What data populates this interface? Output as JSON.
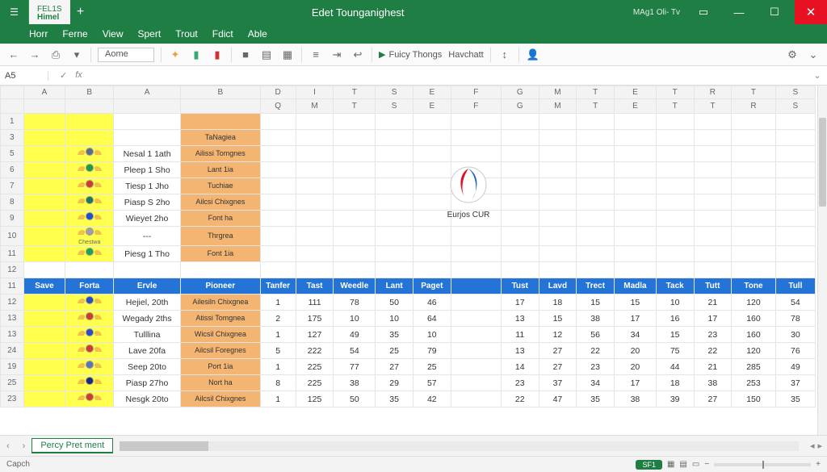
{
  "title": "Edet Tounganighest",
  "user": "MAg1 Oli- Tv",
  "filetab": {
    "line1": "FEL1S",
    "line2": "Himel"
  },
  "menu": [
    "Horr",
    "Ferne",
    "View",
    "Spert",
    "Trout",
    "Fdict",
    "Able"
  ],
  "toolbar": {
    "font": "Aome",
    "ft1": "Fuicy Thongs",
    "ft2": "Havchatt"
  },
  "namebox": "A5",
  "colLetters": [
    "A",
    "B",
    "A",
    "B",
    "D",
    "I",
    "T",
    "S",
    "E",
    "F",
    "G",
    "M",
    "T",
    "E",
    "T",
    "R",
    "T",
    "S"
  ],
  "colSub": [
    "",
    "",
    "",
    "",
    "Q",
    "M",
    "T",
    "S",
    "E",
    "F",
    "G",
    "M",
    "T",
    "E",
    "T",
    "T",
    "R",
    "S"
  ],
  "topRows": [
    {
      "n": "1",
      "a": "",
      "b": "",
      "a2": "",
      "b2": ""
    },
    {
      "n": "3",
      "a": "",
      "b": "",
      "a2": "",
      "b2": "TaNagiea"
    },
    {
      "n": "5",
      "a": "",
      "flag": "#5b6b8c",
      "a2": "Nesal 1 1ath",
      "b2": "Ailissi Tomgnes"
    },
    {
      "n": "6",
      "a": "",
      "flag": "#1a9e3e",
      "a2": "Pleep 1 Sho",
      "b2": "Lant 1ia"
    },
    {
      "n": "7",
      "a": "",
      "flag": "#d43a2a",
      "a2": "Tiesp 1 Jho",
      "b2": "Tuchiae"
    },
    {
      "n": "8",
      "a": "",
      "flag": "#1a7a5a",
      "a2": "Piasp S 2ho",
      "b2": "Ailcsi Chixgnes"
    },
    {
      "n": "9",
      "a": "",
      "flag": "#1a4fd4",
      "a2": "Wieyet 2ho",
      "b2": "Font ha"
    },
    {
      "n": "10",
      "a": "",
      "flag": "#a0a0a0",
      "a2": "---",
      "b2": "Thrgrea",
      "label": "Chestwa"
    },
    {
      "n": "11",
      "a": "",
      "flag": "#1aa74a",
      "a2": "Piesg 1 Tho",
      "b2": "Font 1ia"
    }
  ],
  "headerRow": [
    "Save",
    "Forta",
    "Ervle",
    "Pioneer",
    "Tanfer",
    "Tast",
    "Weedle",
    "Lant",
    "Paget",
    "",
    "Tust",
    "Lavd",
    "Trect",
    "Madla",
    "Tack",
    "Tutt",
    "Tone",
    "Tull"
  ],
  "dataRows": [
    {
      "n": "12",
      "flag": "#2a4ac7",
      "a2": "Hejiel, 20th",
      "b2": "Ailesiln Chixgnea",
      "v": [
        "1",
        "111",
        "78",
        "50",
        "46",
        "",
        "17",
        "18",
        "15",
        "15",
        "10",
        "21",
        "120",
        "54"
      ]
    },
    {
      "n": "13",
      "flag": "#d43a2a",
      "a2": "Wegady 2ths",
      "b2": "Atissi Tomgnea",
      "v": [
        "2",
        "175",
        "10",
        "10",
        "64",
        "",
        "13",
        "15",
        "38",
        "17",
        "16",
        "17",
        "160",
        "78"
      ]
    },
    {
      "n": "13",
      "flag": "#2a4ac7",
      "a2": "Tulllina",
      "b2": "Wicsil Chixgnea",
      "v": [
        "1",
        "127",
        "49",
        "35",
        "10",
        "",
        "11",
        "12",
        "56",
        "34",
        "15",
        "23",
        "160",
        "30"
      ]
    },
    {
      "n": "24",
      "flag": "#d43a2a",
      "a2": "Lave 20fa",
      "b2": "Ailcsil Foregnes",
      "v": [
        "5",
        "222",
        "54",
        "25",
        "79",
        "",
        "13",
        "27",
        "22",
        "20",
        "75",
        "22",
        "120",
        "76"
      ]
    },
    {
      "n": "19",
      "flag": "#5577bb",
      "a2": "Seep 20to",
      "b2": "Port 1ia",
      "v": [
        "1",
        "225",
        "77",
        "27",
        "25",
        "",
        "14",
        "27",
        "23",
        "20",
        "44",
        "21",
        "285",
        "49"
      ]
    },
    {
      "n": "25",
      "flag": "#1a2a7a",
      "a2": "Piasp 27ho",
      "b2": "Nort ha",
      "v": [
        "8",
        "225",
        "38",
        "29",
        "57",
        "",
        "23",
        "37",
        "34",
        "17",
        "18",
        "38",
        "253",
        "37"
      ]
    },
    {
      "n": "23",
      "flag": "#d43a2a",
      "a2": "Nesgk 20to",
      "b2": "Ailcsil Chixgnes",
      "v": [
        "1",
        "125",
        "50",
        "35",
        "42",
        "",
        "22",
        "47",
        "35",
        "38",
        "39",
        "27",
        "150",
        "35"
      ]
    }
  ],
  "logoText": "Eurjos CUR",
  "sheetTab": "Percy Pret ment",
  "status": {
    "left": "Capch",
    "pill": "SF1"
  },
  "chart_data": {
    "type": "table",
    "title": "Edet Tounganighest",
    "columns": [
      "Ervle",
      "Pioneer",
      "Tanfer",
      "Tast",
      "Weedle",
      "Lant",
      "Paget",
      "Tust",
      "Lavd",
      "Trect",
      "Madla",
      "Tack",
      "Tutt",
      "Tone",
      "Tull"
    ],
    "rows": [
      [
        "Hejiel, 20th",
        "Ailesiln Chixgnea",
        1,
        111,
        78,
        50,
        46,
        17,
        18,
        15,
        15,
        10,
        21,
        120,
        54
      ],
      [
        "Wegady 2ths",
        "Atissi Tomgnea",
        2,
        175,
        10,
        10,
        64,
        13,
        15,
        38,
        17,
        16,
        17,
        160,
        78
      ],
      [
        "Tulllina",
        "Wicsil Chixgnea",
        1,
        127,
        49,
        35,
        10,
        11,
        12,
        56,
        34,
        15,
        23,
        160,
        30
      ],
      [
        "Lave 20fa",
        "Ailcsil Foregnes",
        5,
        222,
        54,
        25,
        79,
        13,
        27,
        22,
        20,
        75,
        22,
        120,
        76
      ],
      [
        "Seep 20to",
        "Port 1ia",
        1,
        225,
        77,
        27,
        25,
        14,
        27,
        23,
        20,
        44,
        21,
        285,
        49
      ],
      [
        "Piasp 27ho",
        "Nort ha",
        8,
        225,
        38,
        29,
        57,
        23,
        37,
        34,
        17,
        18,
        38,
        253,
        37
      ],
      [
        "Nesgk 20to",
        "Ailcsil Chixgnes",
        1,
        125,
        50,
        35,
        42,
        22,
        47,
        35,
        38,
        39,
        27,
        150,
        35
      ]
    ]
  }
}
